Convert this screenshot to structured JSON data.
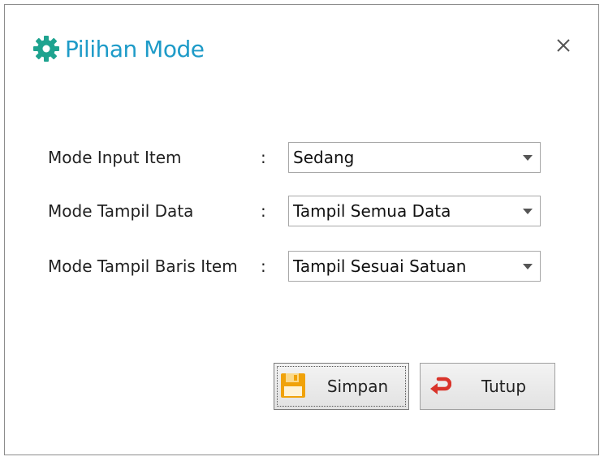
{
  "dialog": {
    "title": "Pilihan Mode",
    "title_icon": "gear-icon",
    "close_icon": "close-icon",
    "title_color": "#1e9bc8",
    "icon_color": "#1ea38f"
  },
  "fields": [
    {
      "label": "Mode Input Item",
      "separator": ":",
      "value": "Sedang"
    },
    {
      "label": "Mode Tampil Data",
      "separator": ":",
      "value": "Tampil Semua Data"
    },
    {
      "label": "Mode Tampil Baris Item",
      "separator": ":",
      "value": "Tampil Sesuai Satuan"
    }
  ],
  "buttons": {
    "save": {
      "label": "Simpan",
      "icon": "floppy-disk-icon",
      "icon_color": "#f0a20a"
    },
    "close": {
      "label": "Tutup",
      "icon": "undo-arrow-icon",
      "icon_color": "#d9342b"
    }
  }
}
